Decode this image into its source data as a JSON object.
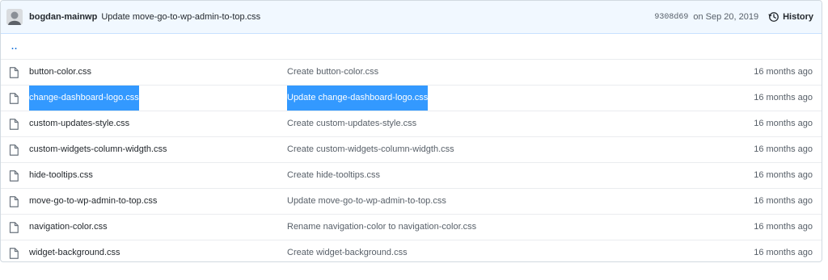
{
  "commit": {
    "author": "bogdan-mainwp",
    "message": "Update move-go-to-wp-admin-to-top.css",
    "sha": "9308d69",
    "date": "on Sep 20, 2019",
    "history_label": "History"
  },
  "parent_dir": "..",
  "files": [
    {
      "name": "button-color.css",
      "commit": "Create button-color.css",
      "age": "16 months ago",
      "selected": false
    },
    {
      "name": "change-dashboard-logo.css",
      "commit": "Update change-dashboard-logo.css",
      "age": "16 months ago",
      "selected": true
    },
    {
      "name": "custom-updates-style.css",
      "commit": "Create custom-updates-style.css",
      "age": "16 months ago",
      "selected": false
    },
    {
      "name": "custom-widgets-column-widgth.css",
      "commit": "Create custom-widgets-column-widgth.css",
      "age": "16 months ago",
      "selected": false
    },
    {
      "name": "hide-tooltips.css",
      "commit": "Create hide-tooltips.css",
      "age": "16 months ago",
      "selected": false
    },
    {
      "name": "move-go-to-wp-admin-to-top.css",
      "commit": "Update move-go-to-wp-admin-to-top.css",
      "age": "16 months ago",
      "selected": false
    },
    {
      "name": "navigation-color.css",
      "commit": "Rename navigation-color to navigation-color.css",
      "age": "16 months ago",
      "selected": false
    },
    {
      "name": "widget-background.css",
      "commit": "Create widget-background.css",
      "age": "16 months ago",
      "selected": false
    }
  ],
  "icons": {
    "file": "file-icon",
    "history": "history-icon",
    "avatar": "avatar"
  },
  "colors": {
    "selection": "#3399ff",
    "commit_bar": "#f1f8ff",
    "link": "#0366d6"
  }
}
